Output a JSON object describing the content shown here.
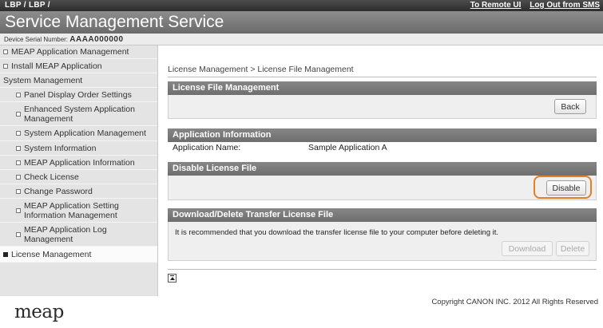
{
  "header": {
    "left_text": "LBP    / LBP    /",
    "remote_ui_link": "To Remote UI",
    "logout_link": "Log Out from SMS",
    "title": "Service Management Service",
    "serial_label": "Device Serial Number:",
    "serial_value": "AAAA000000"
  },
  "sidebar": {
    "items": [
      {
        "label": "MEAP Application Management",
        "level": 0,
        "bullet": true
      },
      {
        "label": "Install MEAP Application",
        "level": 0,
        "bullet": true
      },
      {
        "label": "System Management",
        "level": 0,
        "bullet": false
      },
      {
        "label": "Panel Display Order Settings",
        "level": 1,
        "bullet": true
      },
      {
        "label": "Enhanced System Application Management",
        "level": 1,
        "bullet": true
      },
      {
        "label": "System Application Management",
        "level": 1,
        "bullet": true
      },
      {
        "label": "System Information",
        "level": 1,
        "bullet": true
      },
      {
        "label": "MEAP Application Information",
        "level": 1,
        "bullet": true
      },
      {
        "label": "Check License",
        "level": 1,
        "bullet": true
      },
      {
        "label": "Change Password",
        "level": 1,
        "bullet": true
      },
      {
        "label": "MEAP Application Setting Information Management",
        "level": 1,
        "bullet": true
      },
      {
        "label": "MEAP Application Log Management",
        "level": 1,
        "bullet": true
      },
      {
        "label": "License Management",
        "level": 0,
        "bullet": true,
        "active": true
      }
    ]
  },
  "content": {
    "breadcrumb": "License Management > License File Management",
    "license_panel": {
      "title": "License File Management",
      "back_label": "Back"
    },
    "app_info": {
      "title": "Application Information",
      "name_label": "Application Name:",
      "name_value": "Sample Application A"
    },
    "disable_panel": {
      "title": "Disable License File",
      "disable_label": "Disable"
    },
    "transfer_panel": {
      "title": "Download/Delete Transfer License File",
      "message": "It is recommended that you download the transfer license file to your computer before deleting it.",
      "download_label": "Download",
      "delete_label": "Delete"
    }
  },
  "footer": {
    "copyright": "Copyright CANON INC. 2012 All Rights Reserved",
    "logo_text": "meap"
  },
  "colors": {
    "highlight": "#e67e22",
    "panel_header": "#7a7a7a"
  }
}
